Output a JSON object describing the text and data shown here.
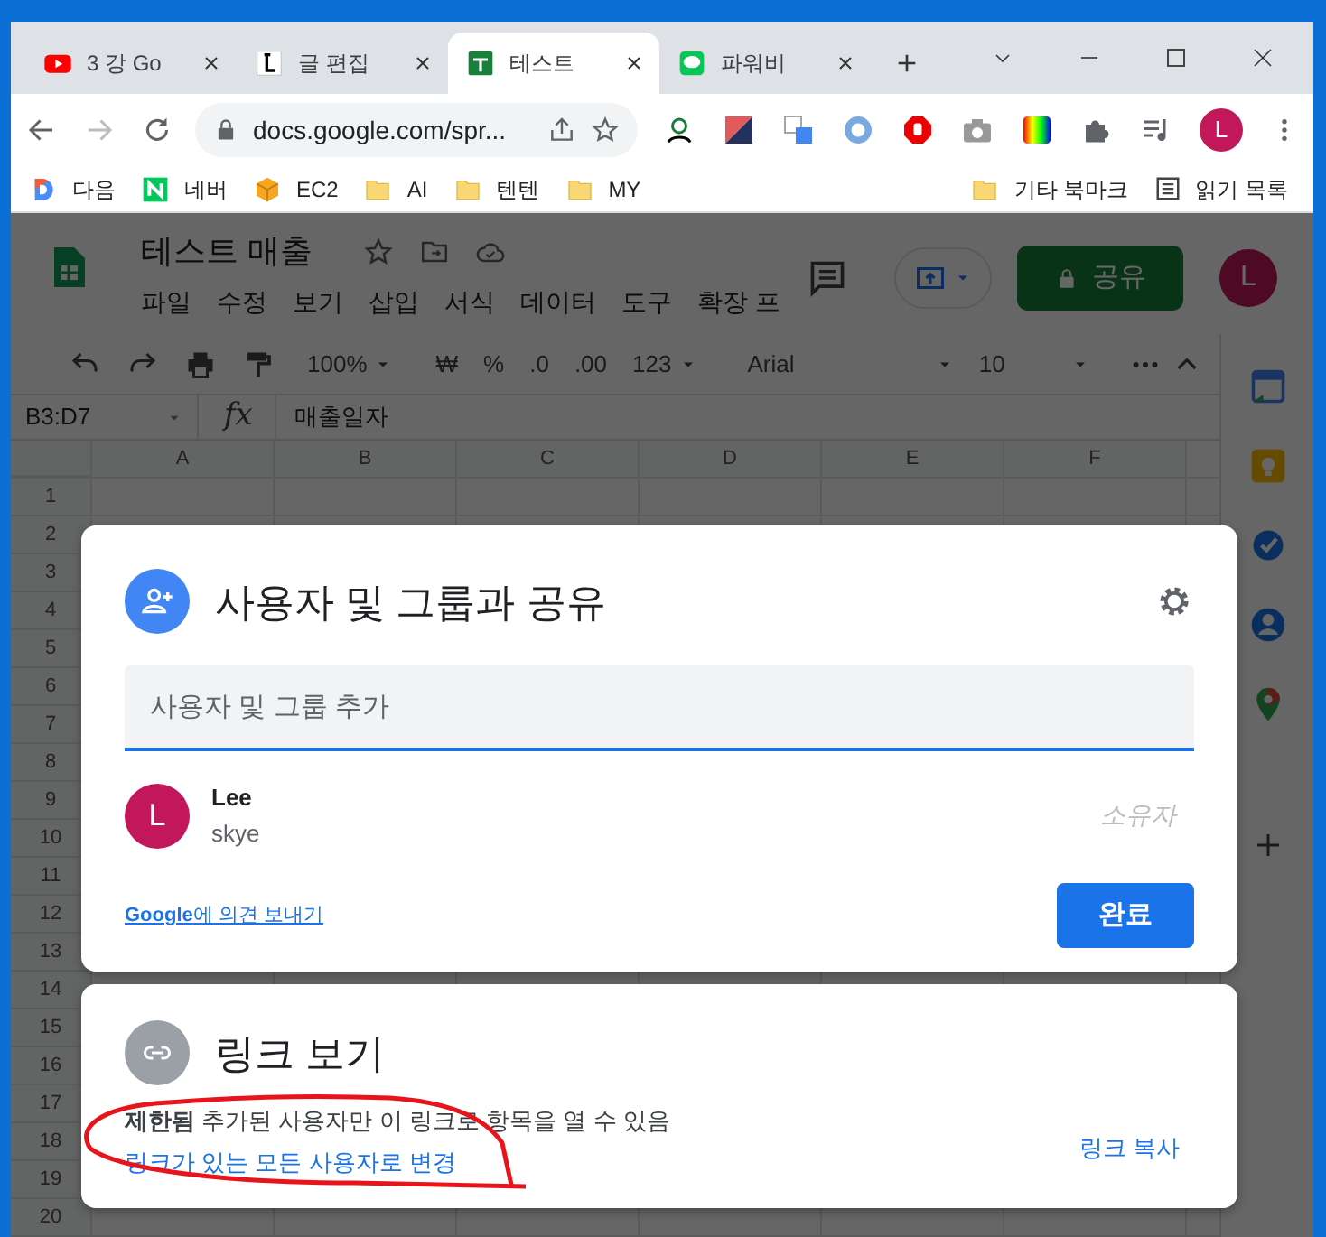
{
  "browser": {
    "tabs": [
      {
        "title": "3 강 Go",
        "selected": false
      },
      {
        "title": "글 편집",
        "selected": false
      },
      {
        "title": "테스트",
        "selected": true
      },
      {
        "title": "파워비",
        "selected": false
      }
    ],
    "address": "docs.google.com/spr...",
    "profile": "L",
    "bookmarks": [
      {
        "label": "다음"
      },
      {
        "label": "네버"
      },
      {
        "label": "EC2"
      },
      {
        "label": "AI"
      },
      {
        "label": "텐텐"
      },
      {
        "label": "MY"
      }
    ],
    "other_bookmarks": "기타 북마크",
    "reading_list": "읽기 목록"
  },
  "sheets": {
    "title": "테스트 매출",
    "menu": [
      "파일",
      "수정",
      "보기",
      "삽입",
      "서식",
      "데이터",
      "도구",
      "확장 프"
    ],
    "share": "공유",
    "avatar": "L",
    "toolbar": [
      {
        "kind": "dropdown",
        "text": "100%"
      },
      {
        "kind": "button",
        "text": "₩"
      },
      {
        "kind": "button",
        "text": "%"
      },
      {
        "kind": "button",
        "text": ".0"
      },
      {
        "kind": "button",
        "text": ".00"
      },
      {
        "kind": "dropdown",
        "text": "123"
      },
      {
        "kind": "dropdown",
        "text": "Arial"
      },
      {
        "kind": "dropdown",
        "text": "10"
      }
    ],
    "name_box": "B3:D7",
    "fx": "fx",
    "formula": "매출일자",
    "columns": [
      "A",
      "B",
      "C",
      "D",
      "E",
      "F"
    ],
    "rows": [
      "1",
      "2",
      "3",
      "4",
      "5",
      "6",
      "7",
      "8",
      "9",
      "10",
      "11",
      "12",
      "13",
      "14",
      "15",
      "16",
      "17",
      "18",
      "19",
      "20"
    ]
  },
  "share_dialog": {
    "title": "사용자 및 그룹과 공유",
    "placeholder": "사용자 및 그룹 추가",
    "user": {
      "initial": "L",
      "name": "Lee",
      "email": "skye",
      "role": "소유자"
    },
    "feedback": "**Google**에 의견 보내기",
    "done": "완료"
  },
  "link_dialog": {
    "title": "링크 보기",
    "description": "**제한됨** 추가된 사용자만 이 링크로 항목을 열 수 있음",
    "change": "링크가 있는 모든 사용자로 변경",
    "copy": "링크 복사"
  }
}
